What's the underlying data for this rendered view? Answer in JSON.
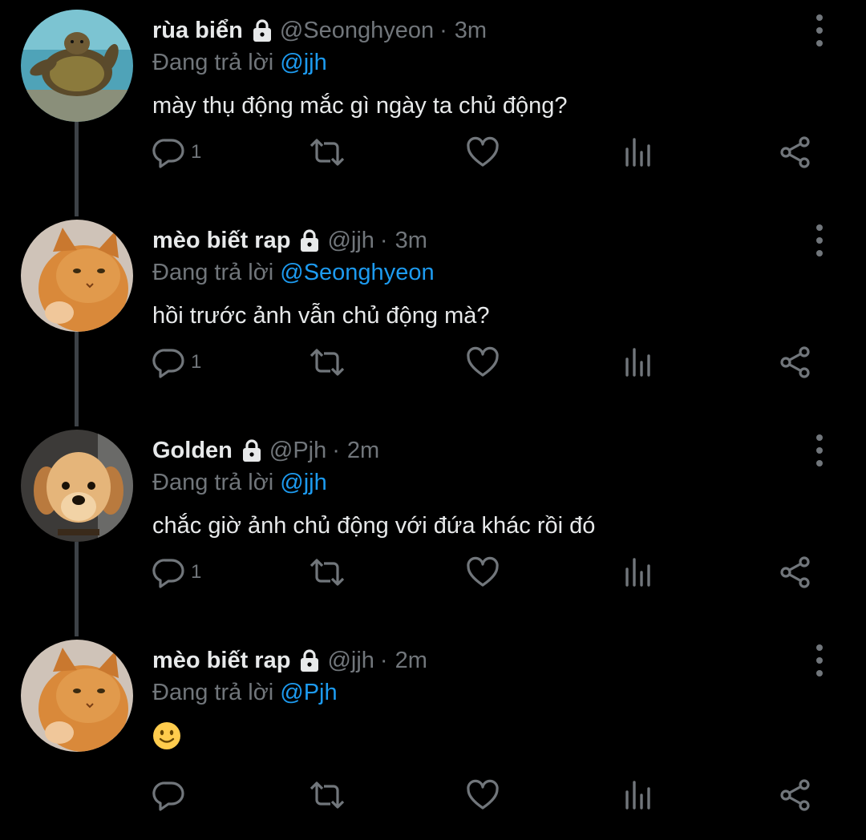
{
  "colors": {
    "background": "#000000",
    "text": "#e7e9ea",
    "secondary": "#71767b",
    "mention": "#1d9bf0",
    "thread_line": "#3d4247"
  },
  "tweets": [
    {
      "name": "rùa biển",
      "handle": "@Seonghyeon",
      "separator": "·",
      "time": "3m",
      "reply_prefix": "Đang trả lời",
      "reply_to": "@jjh",
      "text": "mày thụ động mắc gì ngày ta chủ động?",
      "reply_count": "1",
      "avatar": "sea-turtle-avatar",
      "locked": true
    },
    {
      "name": "mèo biết rap",
      "handle": "@jjh",
      "separator": "·",
      "time": "3m",
      "reply_prefix": "Đang trả lời",
      "reply_to": "@Seonghyeon",
      "text": "hồi trước ảnh vẫn chủ động mà?",
      "reply_count": "1",
      "avatar": "orange-cat-avatar",
      "locked": true
    },
    {
      "name": "Golden",
      "handle": "@Pjh",
      "separator": "·",
      "time": "2m",
      "reply_prefix": "Đang trả lời",
      "reply_to": "@jjh",
      "text": "chắc giờ ảnh chủ động với đứa khác rồi đó",
      "reply_count": "1",
      "avatar": "golden-puppy-avatar",
      "locked": true
    },
    {
      "name": "mèo biết rap",
      "handle": "@jjh",
      "separator": "·",
      "time": "2m",
      "reply_prefix": "Đang trả lời",
      "reply_to": "@Pjh",
      "text": "",
      "emoji": "slightly-smiling-face",
      "reply_count": "",
      "avatar": "orange-cat-avatar",
      "locked": true
    }
  ],
  "icons": {
    "lock": "lock-icon",
    "more": "more-vertical-icon",
    "reply": "reply-icon",
    "retweet": "retweet-icon",
    "like": "heart-icon",
    "views": "analytics-icon",
    "share": "share-icon"
  }
}
